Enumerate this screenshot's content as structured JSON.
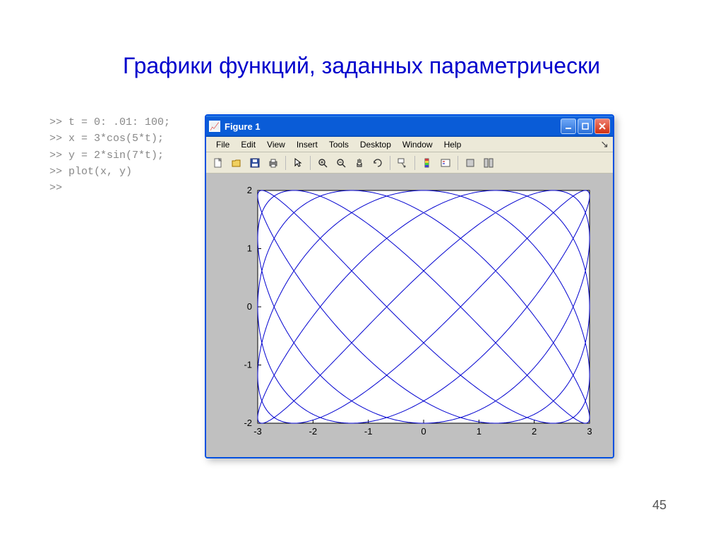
{
  "slide": {
    "title": "Графики функций, заданных параметрически",
    "page_number": "45"
  },
  "code": {
    "lines": [
      ">> t = 0: .01: 100;",
      ">> x = 3*cos(5*t);",
      ">> y = 2*sin(7*t);",
      ">> plot(x, y)",
      ">>"
    ]
  },
  "window": {
    "title": "Figure 1",
    "menu": [
      "File",
      "Edit",
      "View",
      "Insert",
      "Tools",
      "Desktop",
      "Window",
      "Help"
    ]
  },
  "toolbar_icons": [
    "new-icon",
    "open-icon",
    "save-icon",
    "print-icon",
    "pointer-icon",
    "zoom-in-icon",
    "zoom-out-icon",
    "pan-icon",
    "rotate-icon",
    "datacursor-icon",
    "colorbar-icon",
    "legend-icon",
    "hide-plot-tools-icon",
    "show-plot-tools-icon"
  ],
  "chart_data": {
    "type": "line",
    "title": "",
    "xlabel": "",
    "ylabel": "",
    "xlim": [
      -3,
      3
    ],
    "ylim": [
      -2,
      2
    ],
    "xticks": [
      -3,
      -2,
      -1,
      0,
      1,
      2,
      3
    ],
    "yticks": [
      -2,
      -1,
      0,
      1,
      2
    ],
    "parametric": {
      "t_start": 0,
      "t_end": 100,
      "t_step": 0.01,
      "x_expr": "3*cos(5*t)",
      "y_expr": "2*sin(7*t)",
      "ax": 3,
      "ay": 2,
      "fx": 5,
      "fy": 7
    },
    "color": "#0000d0"
  }
}
